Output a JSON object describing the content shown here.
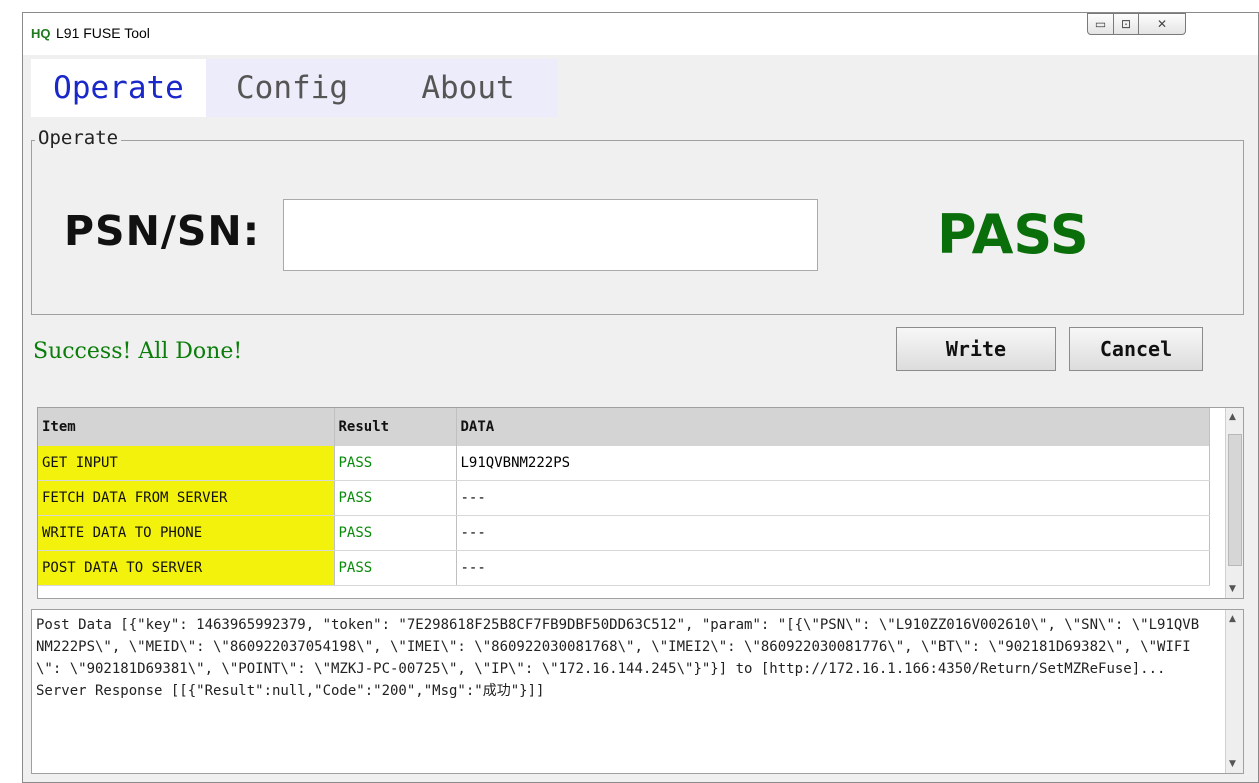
{
  "window": {
    "logo": "HQ",
    "title": "L91 FUSE Tool",
    "min_glyph": "▭",
    "max_glyph": "⊡",
    "close_glyph": "✕"
  },
  "tabs": [
    {
      "label": "Operate",
      "active": true
    },
    {
      "label": "Config",
      "active": false
    },
    {
      "label": "About",
      "active": false
    }
  ],
  "operate": {
    "group_title": "Operate",
    "sn_label": "PSN/SN:",
    "sn_value": "",
    "result_big": "PASS",
    "status_message": "Success! All Done!",
    "write_label": "Write",
    "cancel_label": "Cancel"
  },
  "table": {
    "headers": [
      "Item",
      "Result",
      "DATA"
    ],
    "rows": [
      {
        "item": "GET INPUT",
        "result": "PASS",
        "data": "L91QVBNM222PS"
      },
      {
        "item": "FETCH DATA FROM SERVER",
        "result": "PASS",
        "data": "---"
      },
      {
        "item": "WRITE DATA TO PHONE",
        "result": "PASS",
        "data": "---"
      },
      {
        "item": "POST DATA TO SERVER",
        "result": "PASS",
        "data": "---"
      }
    ]
  },
  "log": {
    "text": "Post Data [{\"key\": 1463965992379, \"token\": \"7E298618F25B8CF7FB9DBF50DD63C512\", \"param\": \"[{\\\"PSN\\\": \\\"L910ZZ016V002610\\\", \\\"SN\\\": \\\"L91QVBNM222PS\\\", \\\"MEID\\\": \\\"860922037054198\\\", \\\"IMEI\\\": \\\"860922030081768\\\", \\\"IMEI2\\\": \\\"860922030081776\\\", \\\"BT\\\": \\\"902181D69382\\\", \\\"WIFI\\\": \\\"902181D69381\\\", \\\"POINT\\\": \\\"MZKJ-PC-00725\\\", \\\"IP\\\": \\\"172.16.144.245\\\"}\"}] to [http://172.16.1.166:4350/Return/SetMZReFuse]...\nServer Response [[{\"Result\":null,\"Code\":\"200\",\"Msg\":\"成功\"}]]"
  },
  "colors": {
    "pass": "#0a6e0a",
    "item_highlight": "#f2f20c",
    "active_tab_text": "#1a27c9"
  }
}
